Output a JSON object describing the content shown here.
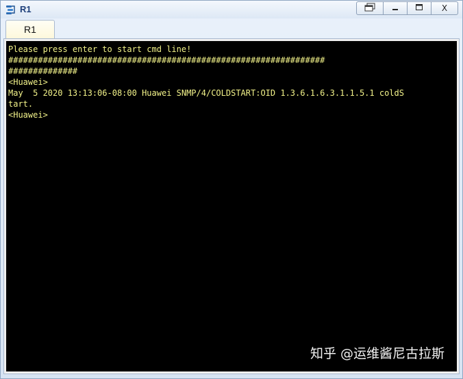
{
  "window": {
    "title": "R1",
    "icon": "router-app-icon",
    "buttons": [
      {
        "name": "restore-windows-button",
        "icon": "restore-windows-icon"
      },
      {
        "name": "minimize-button",
        "icon": "minimize-icon"
      },
      {
        "name": "maximize-button",
        "icon": "maximize-icon"
      },
      {
        "name": "close-button",
        "label": "X",
        "icon": "close-icon"
      }
    ]
  },
  "tabs": [
    {
      "label": "R1",
      "active": true
    }
  ],
  "terminal": {
    "lines": [
      "Please press enter to start cmd line!",
      "################################################################",
      "##############",
      "<Huawei>",
      "May  5 2020 13:13:06-08:00 Huawei SNMP/4/COLDSTART:OID 1.3.6.1.6.3.1.1.5.1 coldS",
      "tart.",
      "<Huawei>"
    ],
    "text_color": "#f3f38a",
    "background_color": "#000000"
  },
  "watermark": {
    "text": "知乎 @运维酱尼古拉斯"
  }
}
